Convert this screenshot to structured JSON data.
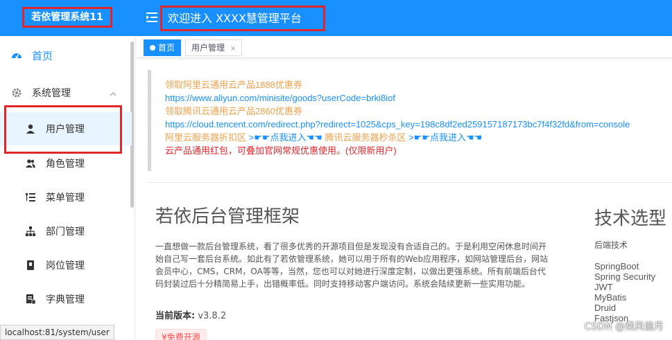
{
  "header": {
    "logo_title": "若依管理系统11",
    "welcome": "欢迎进入 XXXX慧管理平台"
  },
  "sidebar": {
    "items": [
      {
        "label": "首页",
        "icon": "dashboard-icon"
      },
      {
        "label": "系统管理",
        "icon": "gear-icon",
        "expanded": true
      },
      {
        "label": "用户管理",
        "icon": "user-icon",
        "active": true
      },
      {
        "label": "角色管理",
        "icon": "peoples-icon"
      },
      {
        "label": "菜单管理",
        "icon": "tree-table-icon"
      },
      {
        "label": "部门管理",
        "icon": "tree-icon"
      },
      {
        "label": "岗位管理",
        "icon": "post-icon"
      },
      {
        "label": "字典管理",
        "icon": "dict-icon"
      }
    ]
  },
  "tags": [
    {
      "label": "首页",
      "active": true
    },
    {
      "label": "用户管理",
      "close": "×"
    }
  ],
  "promo": {
    "line1": "领取阿里云通用云产品1888优惠券",
    "line2": "https://www.aliyun.com/minisite/goods?userCode=brki8iof",
    "line3": "领取腾讯云通用云产品2860优惠券",
    "line4": "https://cloud.tencent.com/redirect.php?redirect=1025&cps_key=198c8df2ed259157187173bc7f4f32fd&from=console",
    "line5a": "阿里云服务器折扣区",
    "line5b": " >☛☛点我进入☚☚ ",
    "line5c": "腾讯云服务器秒杀区",
    "line5d": " >☛☛点我进入☚☚",
    "line6": "云产品通用红包，可叠加官网常规优惠使用。(仅限新用户)"
  },
  "intro": {
    "title": "若依后台管理框架",
    "text": "一直想做一款后台管理系统，看了很多优秀的开源项目但是发现没有合适自己的。于是利用空闲休息时间开始自己写一套后台系统。如此有了若依管理系统，她可以用于所有的Web应用程序，如网站管理后台，网站会员中心，CMS，CRM，OA等等，当然，您也可以对她进行深度定制，以做出更强系统。所有前端后台代码封装过后十分精简易上手，出错概率低。同时支持移动客户端访问。系统会陆续更新一些实用功能。",
    "version_label": "当前版本:",
    "version_value": " v3.8.2",
    "free_button": "¥免费开源"
  },
  "tech": {
    "title": "技术选型",
    "backend_label": "后端技术",
    "items": [
      "SpringBoot",
      "Spring Security",
      "JWT",
      "MyBatis",
      "Druid",
      "Fastjson"
    ]
  },
  "watermark": "CSDN @乘风偷月",
  "statusbar": "localhost:81/system/user",
  "colors": {
    "primary": "#1890ff",
    "highlight_border": "#e0262a",
    "promo_orange": "#f0a04b",
    "promo_red": "#e0262a"
  }
}
